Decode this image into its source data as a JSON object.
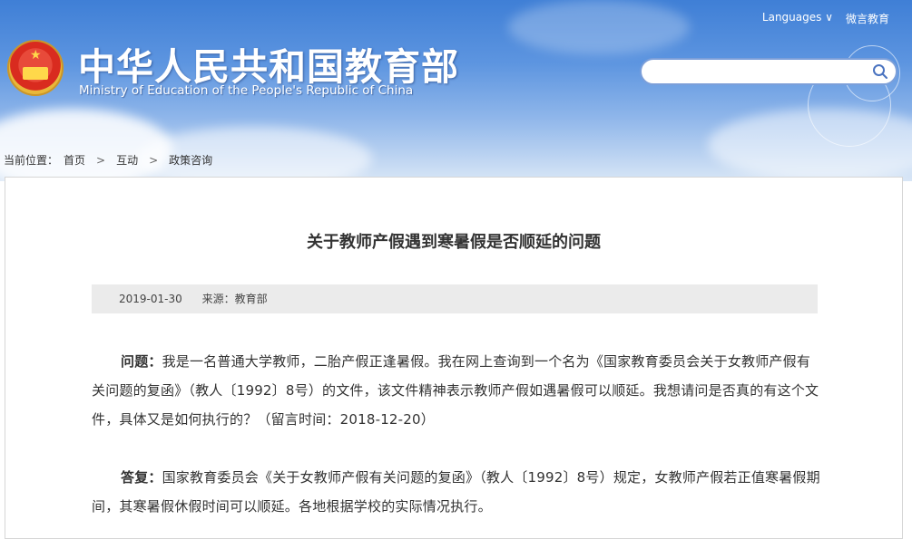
{
  "header": {
    "site_title": "中华人民共和国教育部",
    "site_subtitle": "Ministry of Education of the People's Republic of China",
    "languages_label": "Languages ∨",
    "weibo_label": "微言教育",
    "search_placeholder": ""
  },
  "breadcrumb": {
    "prefix": "当前位置：",
    "items": [
      "首页",
      "互动",
      "政策咨询"
    ],
    "separator": ">"
  },
  "article": {
    "title": "关于教师产假遇到寒暑假是否顺延的问题",
    "date": "2019-01-30",
    "source": "来源：教育部",
    "question_label": "问题：",
    "question_text": "我是一名普通大学教师，二胎产假正逢暑假。我在网上查询到一个名为《国家教育委员会关于女教师产假有关问题的复函》（教人〔1992〕8号）的文件，该文件精神表示教师产假如遇暑假可以顺延。我想请问是否真的有这个文件，具体又是如何执行的？（留言时间：2018-12-20）",
    "answer_label": "答复：",
    "answer_text": "国家教育委员会《关于女教师产假有关问题的复函》（教人〔1992〕8号）规定，女教师产假若正值寒暑假期间，其寒暑假休假时间可以顺延。各地根据学校的实际情况执行。"
  },
  "colors": {
    "banner_top": "#3f7fd6",
    "banner_bottom": "#d8e6f6",
    "emblem_red": "#d92b1f",
    "emblem_gold": "#e8b83a",
    "meta_bar_bg": "#ebebeb",
    "text": "#333333"
  },
  "icons": {
    "search": "search-icon",
    "emblem": "national-emblem-icon"
  }
}
